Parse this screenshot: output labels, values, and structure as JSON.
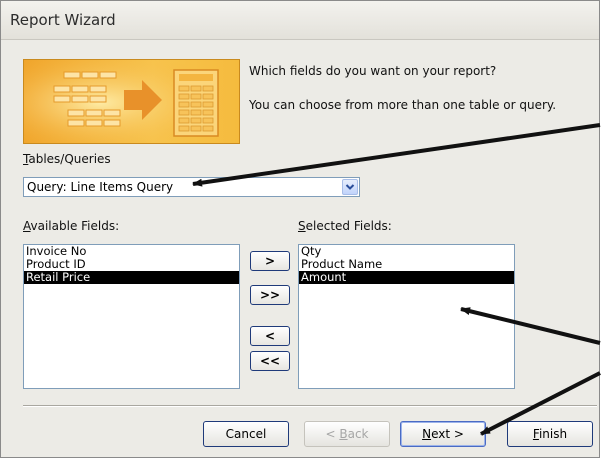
{
  "window": {
    "title": "Report Wizard"
  },
  "prompt": {
    "question": "Which fields do you want on your report?",
    "hint": "You can choose from more than one table or query."
  },
  "tables_queries": {
    "label_accel": "T",
    "label_rest": "ables/Queries",
    "selected": "Query: Line Items Query"
  },
  "available_fields": {
    "label_accel": "A",
    "label_rest": "vailable Fields:",
    "items": [
      {
        "label": "Invoice No",
        "selected": false
      },
      {
        "label": "Product ID",
        "selected": false
      },
      {
        "label": "Retail Price",
        "selected": true
      }
    ]
  },
  "selected_fields": {
    "label_accel": "S",
    "label_rest": "elected Fields:",
    "items": [
      {
        "label": "Qty",
        "selected": false
      },
      {
        "label": "Product Name",
        "selected": false
      },
      {
        "label": "Amount",
        "selected": true
      }
    ]
  },
  "move_buttons": {
    "add_one": ">",
    "add_all": ">>",
    "remove_one": "<",
    "remove_all": "<<"
  },
  "footer": {
    "cancel": "Cancel",
    "back_accel": "B",
    "back_prefix": "< ",
    "back_rest": "ack",
    "next_accel": "N",
    "next_rest": "ext >",
    "finish_accel": "F",
    "finish_rest": "inish"
  },
  "colors": {
    "dialog_bg": "#ecebe6",
    "selection_bg": "#000000",
    "banner_orange": "#f5b33c",
    "annotation_arrow": "#111111"
  }
}
